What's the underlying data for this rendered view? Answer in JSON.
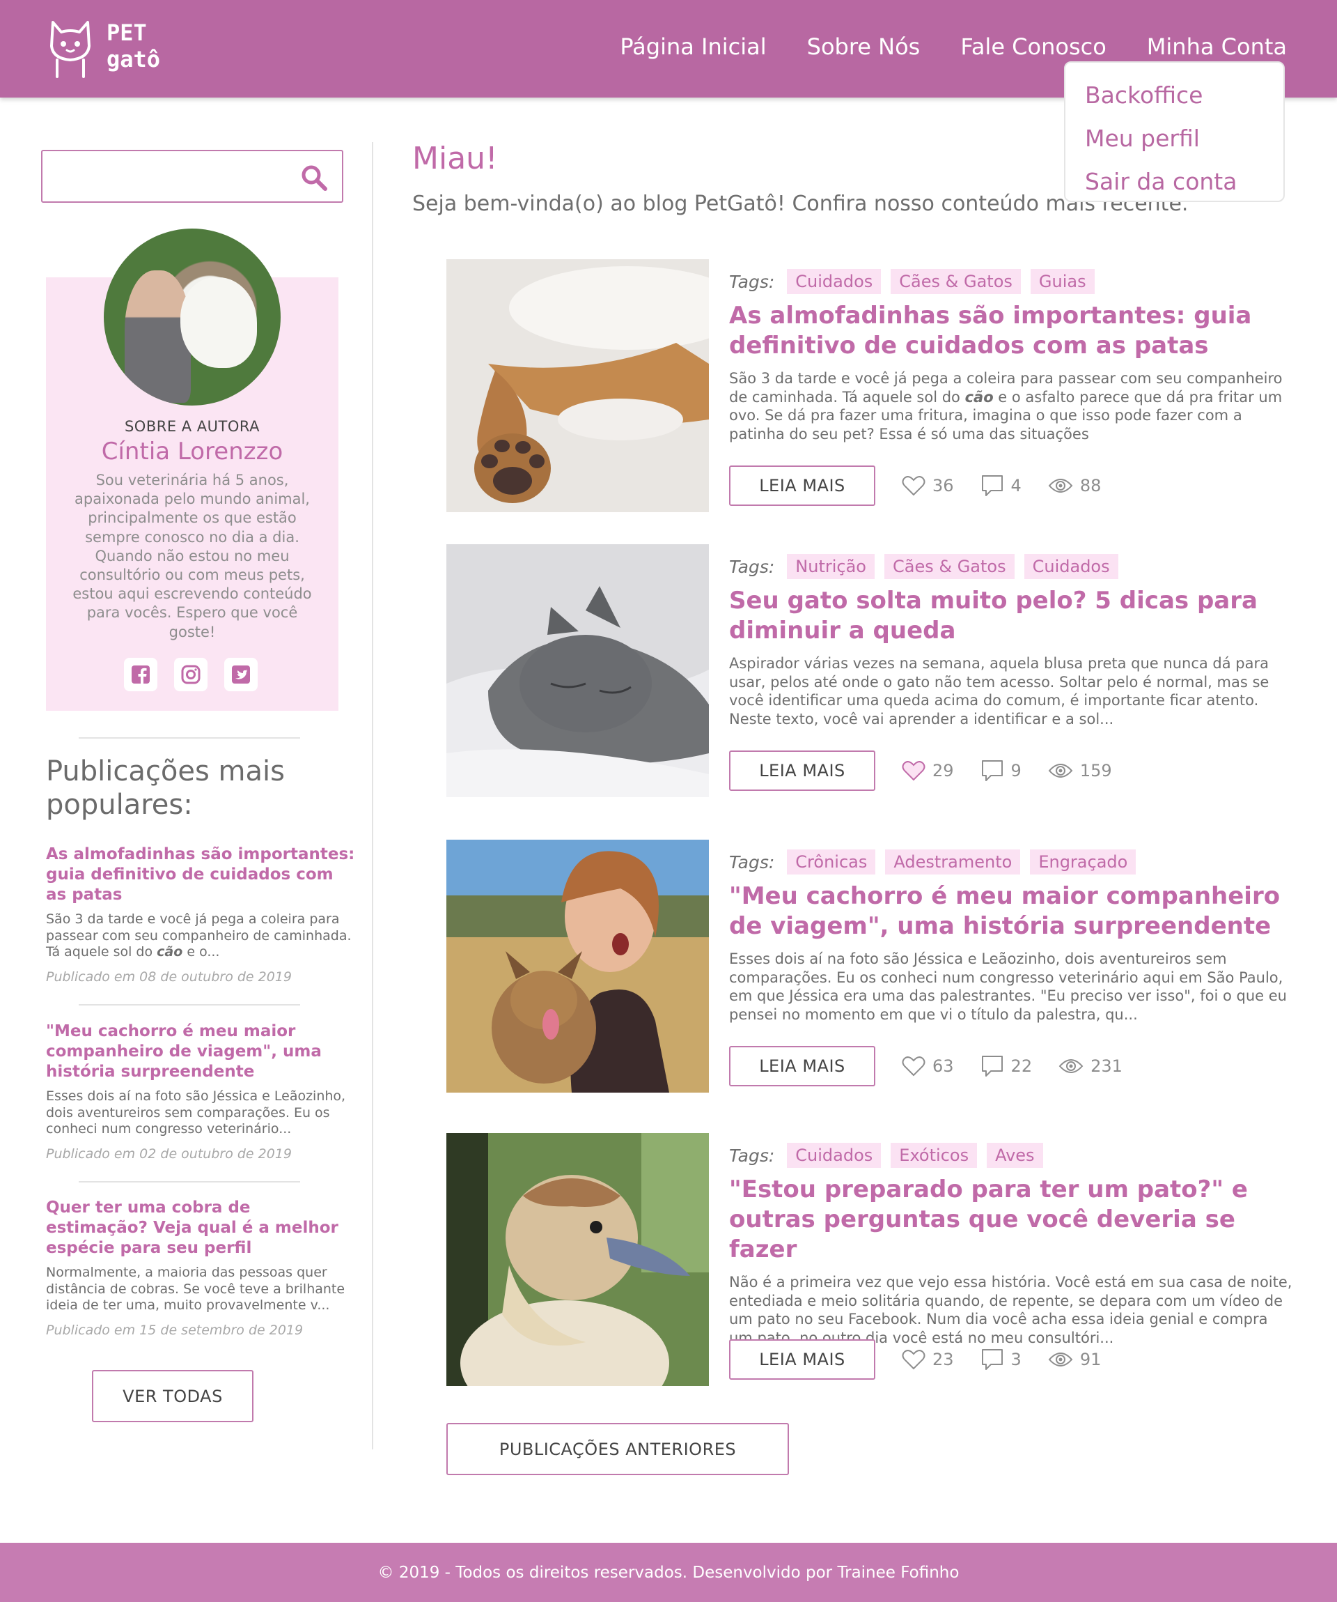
{
  "header": {
    "logo_text_line1": "PET",
    "logo_text_line2": "gatô",
    "nav": [
      "Página Inicial",
      "Sobre Nós",
      "Fale Conosco",
      "Minha Conta"
    ],
    "dropdown": [
      "Backoffice",
      "Meu perfil",
      "Sair da conta"
    ]
  },
  "search": {
    "placeholder": ""
  },
  "author": {
    "label": "SOBRE A AUTORA",
    "name": "Cíntia Lorenzzo",
    "bio": "Sou veterinária há 5 anos, apaixonada pelo mundo animal, principalmente os que estão sempre conosco no dia a dia. Quando não estou no meu consultório ou com meus pets, estou aqui escrevendo conteúdo para vocês. Espero que você goste!",
    "social_icons": [
      "facebook-icon",
      "instagram-icon",
      "twitter-icon"
    ]
  },
  "popular": {
    "title": "Publicações mais populares:",
    "items": [
      {
        "title": "As almofadinhas são importantes: guia definitivo de cuidados com as patas",
        "excerpt_before": "São 3 da tarde e você já pega a coleira para passear com seu companheiro de caminhada. Tá aquele sol do ",
        "excerpt_em": "cão",
        "excerpt_after": " e o...",
        "date": "Publicado em 08 de outubro de 2019"
      },
      {
        "title": "\"Meu cachorro é meu maior companheiro de viagem\", uma história surpreendente",
        "excerpt_before": "Esses dois aí na foto são Jéssica e Leãozinho, dois aventureiros sem comparações. Eu os conheci num congresso veterinário...",
        "excerpt_em": "",
        "excerpt_after": "",
        "date": "Publicado em 02 de outubro de 2019"
      },
      {
        "title": "Quer ter uma cobra de estimação? Veja qual é a melhor espécie para seu perfil",
        "excerpt_before": "Normalmente, a maioria das pessoas quer distância de cobras. Se você teve a brilhante ideia de ter uma, muito provavelmente v...",
        "excerpt_em": "",
        "excerpt_after": "",
        "date": "Publicado em 15 de setembro de 2019"
      }
    ],
    "see_all": "VER TODAS"
  },
  "main": {
    "hello": "Miau!",
    "welcome": "Seja bem-vinda(o) ao blog PetGatô! Confira nosso conteúdo mais recente.",
    "tags_label": "Tags:",
    "read_more": "LEIA MAIS",
    "previous": "PUBLICAÇÕES ANTERIORES",
    "posts": [
      {
        "tags": [
          "Cuidados",
          "Cães & Gatos",
          "Guias"
        ],
        "title": "As almofadinhas são importantes: guia definitivo de cuidados com as patas",
        "excerpt_before": "São 3 da tarde e você já pega a coleira para passear com seu companheiro de caminhada. Tá aquele sol do ",
        "excerpt_em": "cão",
        "excerpt_after": " e o asfalto parece que dá pra fritar um ovo. Se dá pra fazer uma fritura, imagina o que isso pode fazer com a patinha do seu pet? Essa é só uma das situações",
        "likes": "36",
        "comments": "4",
        "views": "88",
        "liked": false,
        "image": "dog-paws-photo"
      },
      {
        "tags": [
          "Nutrição",
          "Cães & Gatos",
          "Cuidados"
        ],
        "title": "Seu gato solta muito pelo? 5 dicas para diminuir a queda",
        "excerpt_before": "Aspirador várias vezes na semana, aquela blusa preta que nunca dá para usar, pelos até onde o gato não tem acesso. Soltar pelo é normal, mas se você identificar uma queda acima do comum, é importante ficar atento. Neste texto, você vai aprender a identificar e a sol...",
        "excerpt_em": "",
        "excerpt_after": "",
        "likes": "29",
        "comments": "9",
        "views": "159",
        "liked": true,
        "image": "sleeping-gray-cat-photo"
      },
      {
        "tags": [
          "Crônicas",
          "Adestramento",
          "Engraçado"
        ],
        "title": "\"Meu cachorro é meu maior companheiro de viagem\", uma história surpreendente",
        "excerpt_before": "Esses dois aí na foto são Jéssica e Leãozinho, dois aventureiros sem comparações. Eu os conheci num congresso veterinário aqui em São Paulo, em que Jéssica era uma das palestrantes. \"Eu preciso ver isso\", foi o que eu pensei no momento em que vi o título da palestra, qu...",
        "excerpt_em": "",
        "excerpt_after": "",
        "likes": "63",
        "comments": "22",
        "views": "231",
        "liked": false,
        "image": "woman-with-dog-photo"
      },
      {
        "tags": [
          "Cuidados",
          "Exóticos",
          "Aves"
        ],
        "title": "\"Estou preparado para ter um pato?\" e outras perguntas que você deveria se fazer",
        "excerpt_before": "Não é a primeira vez que vejo essa história. Você está em sua casa de noite, entediada e meio solitária quando, de repente, se depara com um vídeo de um pato no seu Facebook. Num dia você acha essa ideia genial e compra um pato, no outro dia você está no meu consultóri...",
        "excerpt_em": "",
        "excerpt_after": "",
        "likes": "23",
        "comments": "3",
        "views": "91",
        "liked": false,
        "image": "duckling-photo"
      }
    ]
  },
  "footer": {
    "text": "© 2019 - Todos os direitos reservados. Desenvolvido por Trainee Fofinho"
  },
  "colors": {
    "brand": "#b868a2",
    "accent_text": "#c06aa8",
    "tag_bg": "#fbe2f3",
    "author_bg": "#fbe5f3",
    "footer": "#c67cb2"
  }
}
